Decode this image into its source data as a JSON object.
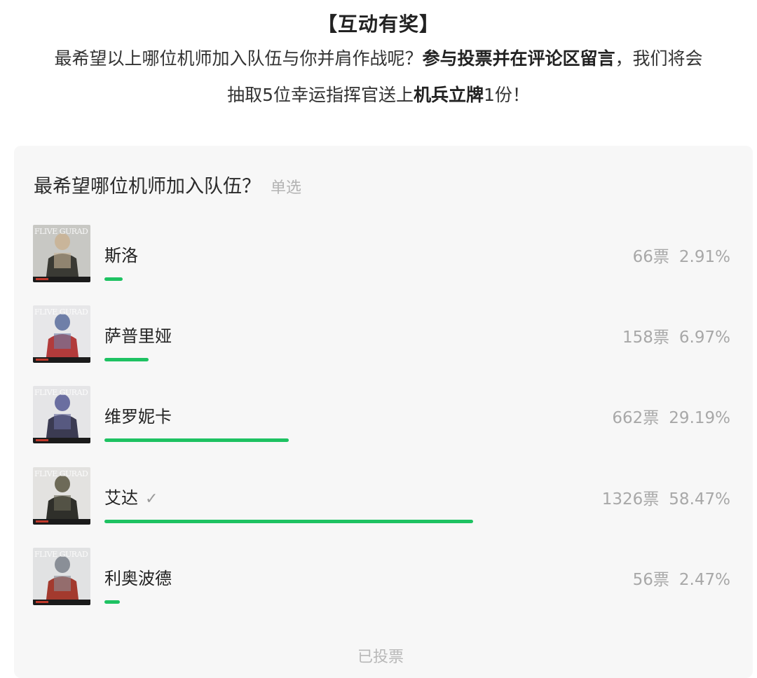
{
  "intro": {
    "title": "【互动有奖】",
    "line1_a": "最希望以上哪位机师加入队伍与你并肩作战呢？",
    "line1_b": "参与投票并在评论区留言",
    "line1_c": "，我们将会",
    "line2_a": "抽取5位幸运指挥官送上",
    "line2_b": "机兵立牌",
    "line2_c": "1份！"
  },
  "vote": {
    "question": "最希望哪位机师加入队伍？",
    "type": "单选",
    "more_label": "已投票",
    "accent_color": "#1ec262",
    "options": [
      {
        "name": "斯洛",
        "votes": "66票",
        "percent": "2.91%",
        "ratio": 0.0291,
        "selected": false,
        "thumb_text": "FLIVE GURAD",
        "thumb_icon": "pilot-portrait-icon"
      },
      {
        "name": "萨普里娅",
        "votes": "158票",
        "percent": "6.97%",
        "ratio": 0.0697,
        "selected": false,
        "thumb_text": "FLIVE GURAD",
        "thumb_icon": "pilot-portrait-icon"
      },
      {
        "name": "维罗妮卡",
        "votes": "662票",
        "percent": "29.19%",
        "ratio": 0.2919,
        "selected": false,
        "thumb_text": "FLIVE GURAD",
        "thumb_icon": "pilot-portrait-icon"
      },
      {
        "name": "艾达",
        "votes": "1326票",
        "percent": "58.47%",
        "ratio": 0.5847,
        "selected": true,
        "check_glyph": "✓",
        "thumb_text": "FLIVE GURAD",
        "thumb_icon": "pilot-portrait-icon"
      },
      {
        "name": "利奥波德",
        "votes": "56票",
        "percent": "2.47%",
        "ratio": 0.0247,
        "selected": false,
        "thumb_text": "FLIVE GURAD",
        "thumb_icon": "pilot-portrait-icon"
      }
    ]
  }
}
